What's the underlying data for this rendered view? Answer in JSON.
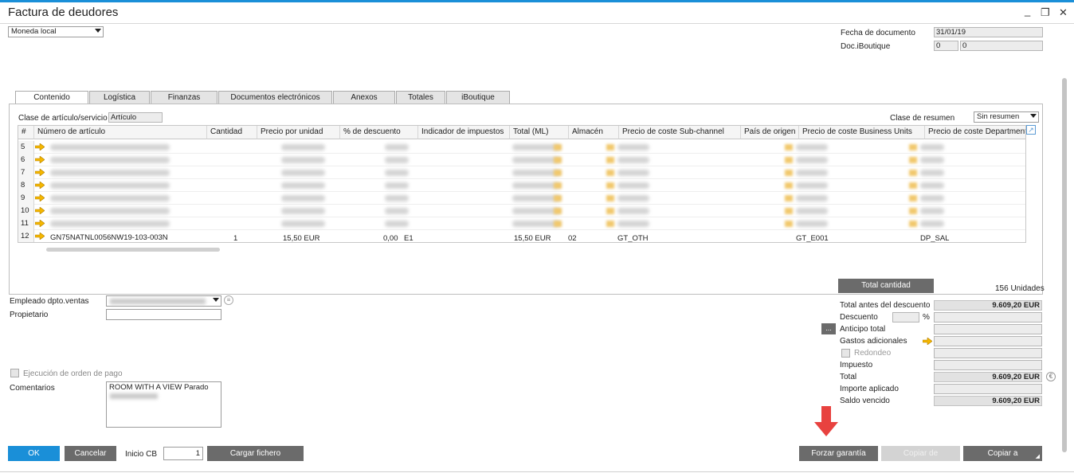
{
  "window": {
    "title": "Factura de deudores",
    "controls": [
      "_",
      "❐",
      "✕"
    ]
  },
  "header": {
    "currency": "Moneda local",
    "fecha_documento_label": "Fecha de documento",
    "fecha_documento_value": "31/01/19",
    "doc_iboutique_label": "Doc.iBoutique",
    "doc_iboutique_value1": "0",
    "doc_iboutique_value2": "0"
  },
  "tabs": [
    "Contenido",
    "Logística",
    "Finanzas",
    "Documentos electrónicos",
    "Anexos",
    "Totales",
    "iBoutique"
  ],
  "content": {
    "clase_articulo_label": "Clase de artículo/servicio",
    "clase_articulo_value": "Artículo",
    "clase_resumen_label": "Clase de resumen",
    "clase_resumen_value": "Sin resumen"
  },
  "grid": {
    "columns": [
      "#",
      "Número de artículo",
      "Cantidad",
      "Precio por unidad",
      "% de descuento",
      "Indicador de impuestos",
      "Total (ML)",
      "Almacén",
      "Precio de coste Sub-channel",
      "País de origen",
      "Precio de coste Business Units",
      "Precio de coste Departments"
    ],
    "row_numbers": [
      "5",
      "6",
      "7",
      "8",
      "9",
      "10",
      "11",
      "12"
    ],
    "last_row": {
      "item": "GN75NATNL0056NW19-103-003N",
      "qty": "1",
      "price": "15,50 EUR",
      "discount": "0,00",
      "tax": "E1",
      "total": "15,50 EUR",
      "warehouse": "02",
      "subchannel": "GT_OTH",
      "bu": "GT_E001",
      "dept": "DP_SAL"
    }
  },
  "totals": {
    "total_cantidad_label": "Total cantidad",
    "total_cantidad_value": "156 Unidades",
    "total_antes_label": "Total antes del descuento",
    "total_antes_value": "9.609,20 EUR",
    "descuento_label": "Descuento",
    "descuento_pct": "%",
    "anticipo_label": "Anticipo total",
    "gastos_label": "Gastos adicionales",
    "redondeo_label": "Redondeo",
    "impuesto_label": "Impuesto",
    "total_label": "Total",
    "total_value": "9.609,20 EUR",
    "importe_label": "Importe aplicado",
    "saldo_label": "Saldo vencido",
    "saldo_value": "9.609,20 EUR",
    "dots_button": "..."
  },
  "footer": {
    "empleado_label": "Empleado dpto.ventas",
    "propietario_label": "Propietario",
    "ejecucion_label": "Ejecución de orden de pago",
    "comentarios_label": "Comentarios",
    "comentarios_text": "ROOM WITH A VIEW Parado",
    "inicio_cb_label": "Inicio CB",
    "inicio_cb_value": "1"
  },
  "buttons": {
    "ok": "OK",
    "cancelar": "Cancelar",
    "cargar_fichero": "Cargar fichero",
    "forzar_garantia": "Forzar garantía",
    "copiar_de": "Copiar de",
    "copiar_a": "Copiar a"
  },
  "colors": {
    "accent": "#1a8fd8",
    "button_gray": "#6b6b6b",
    "pointer_red": "#e8423f"
  }
}
